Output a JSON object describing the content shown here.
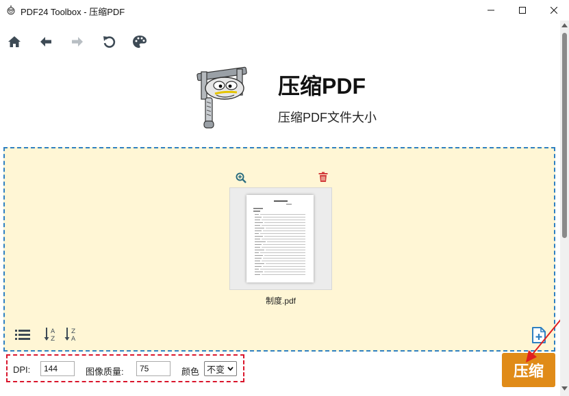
{
  "window": {
    "title": "PDF24 Toolbox - 压缩PDF",
    "app_icon": "pdf24-mascot-icon"
  },
  "toolbar": {
    "items": [
      "home-icon",
      "back-icon",
      "forward-icon",
      "undo-icon",
      "palette-icon"
    ]
  },
  "header": {
    "title": "压缩PDF",
    "subtitle": "压缩PDF文件大小",
    "mascot": "pdf24-press-mascot"
  },
  "dropzone": {
    "files": [
      {
        "name": "制度.pdf"
      }
    ],
    "file_actions": [
      "zoom-in-icon",
      "trash-icon"
    ],
    "bottom_tools": [
      "list-view-icon",
      "sort-a-z-icon",
      "sort-z-a-icon",
      "add-file-icon"
    ]
  },
  "options": {
    "dpi_label": "DPI:",
    "dpi_value": "144",
    "quality_label": "图像质量:",
    "quality_value": "75",
    "color_label": "颜色",
    "color_value": "不变"
  },
  "compress_button_label": "压缩",
  "colors": {
    "accent": "#e08b18",
    "dropzone_bg": "#fff6d5",
    "dropzone_border": "#2d7fc1",
    "highlight_border": "#d9142a",
    "icon_dark": "#3d4a55"
  }
}
